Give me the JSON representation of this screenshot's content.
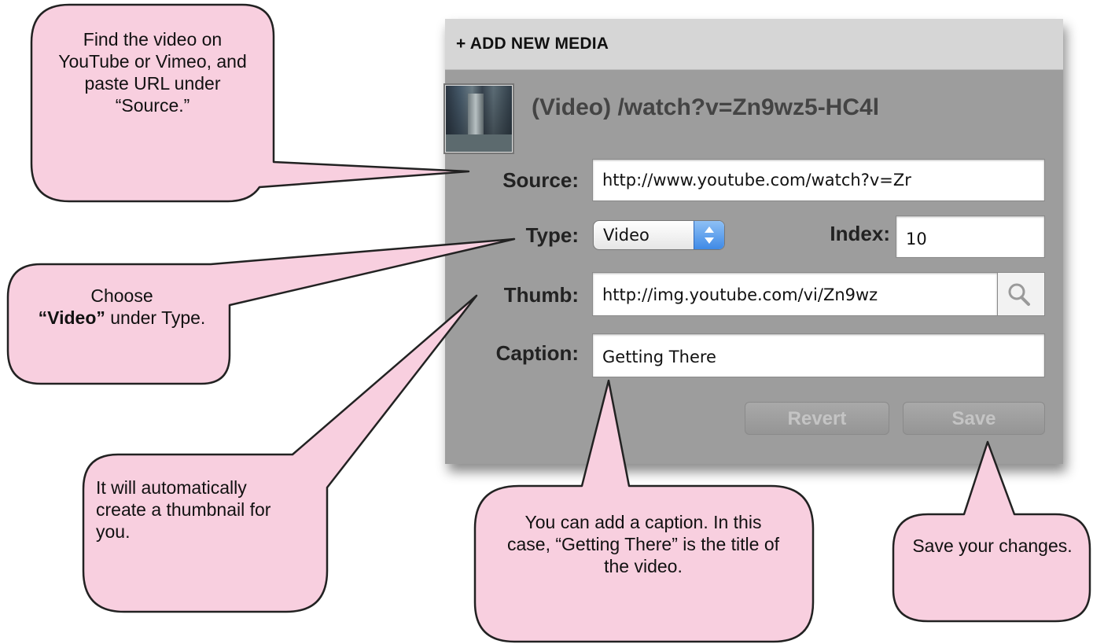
{
  "panel": {
    "header_title": "+ ADD NEW MEDIA",
    "media_title": "(Video) /watch?v=Zn9wz5-HC4l",
    "source": {
      "label": "Source:",
      "value": "http://www.youtube.com/watch?v=Zr"
    },
    "type": {
      "label": "Type:",
      "selected": "Video"
    },
    "index": {
      "label": "Index:",
      "value": "10"
    },
    "thumb": {
      "label": "Thumb:",
      "value": "http://img.youtube.com/vi/Zn9wz"
    },
    "caption": {
      "label": "Caption:",
      "value": "Getting There"
    },
    "revert_label": "Revert",
    "save_label": "Save"
  },
  "callouts": {
    "find_video": "Find the video on YouTube or Vimeo, and paste URL under “Source.”",
    "choose_pre": "Choose",
    "choose_bold": "“Video”",
    "choose_post": "under Type.",
    "thumbnail": "It will automatically create a thumbnail for you.",
    "caption_note": "You can add a caption. In this case, “Getting There” is the title of the video.",
    "save_note": "Save your changes."
  },
  "colors": {
    "callout_fill": "#f8cfdf",
    "panel_bg": "#9d9d9d",
    "header_bg": "#d6d6d6"
  },
  "icons": [
    "magnifier-icon",
    "stepper-arrows-icon"
  ]
}
